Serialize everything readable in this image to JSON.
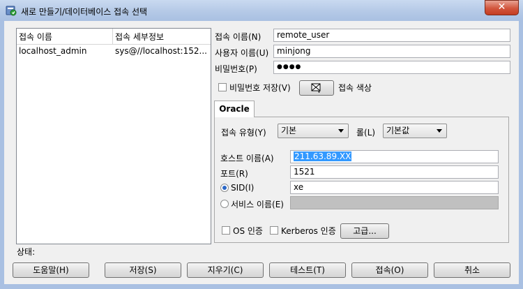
{
  "window": {
    "title": "새로 만들기/데이터베이스 접속 선택",
    "close_glyph": "✕"
  },
  "connection_list": {
    "columns": [
      "접속 이름",
      "접속 세부정보"
    ],
    "rows": [
      {
        "name": "localhost_admin",
        "details": "sys@//localhost:152..."
      }
    ]
  },
  "form": {
    "conn_name_label": "접속 이름(N)",
    "conn_name_value": "remote_user",
    "username_label": "사용자 이름(U)",
    "username_value": "minjong",
    "password_label": "비밀번호(P)",
    "password_value": "●●●●",
    "save_password_label": "비밀번호 저장(V)",
    "save_password_checked": false,
    "conn_color_label": "접속 색상"
  },
  "tab": {
    "label": "Oracle"
  },
  "oracle": {
    "conn_type_label": "접속 유형(Y)",
    "conn_type_value": "기본",
    "role_label": "롤(L)",
    "role_value": "기본값",
    "host_label": "호스트 이름(A)",
    "host_value": "211.63.89.XX",
    "port_label": "포트(R)",
    "port_value": "1521",
    "sid_label": "SID(I)",
    "sid_value": "xe",
    "sid_selected": true,
    "service_label": "서비스 이름(E)",
    "service_value": "",
    "os_auth_label": "OS 인증",
    "kerberos_label": "Kerberos 인증",
    "advanced_label": "고급..."
  },
  "status": {
    "label": "상태:"
  },
  "buttons": {
    "help": "도움말(H)",
    "save": "저장(S)",
    "clear": "지우기(C)",
    "test": "테스트(T)",
    "connect": "접속(O)",
    "cancel": "취소"
  },
  "colors": {
    "titlebar": "#b3c8e6",
    "close": "#c43d22",
    "selection": "#3399ff"
  }
}
